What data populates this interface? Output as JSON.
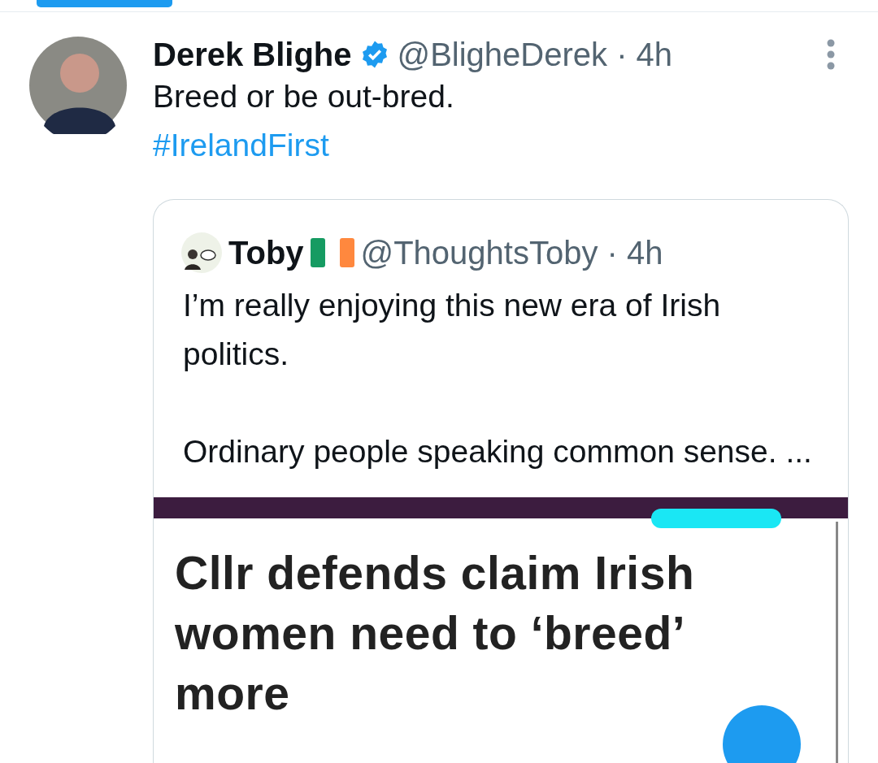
{
  "tweet": {
    "author": "Derek Blighe",
    "verified": true,
    "meta": "@BligheDerek · 4h",
    "text": "Breed or be out-bred.",
    "hashtag": "#IrelandFirst",
    "quote": {
      "author": "Toby",
      "meta": "@ThoughtsToby · 4h",
      "paragraphs": [
        "I’m really enjoying this new era of Irish politics.",
        "Ordinary people speaking common sense. ..."
      ],
      "headline": "Cllr defends claim Irish women need to ‘breed’ more"
    }
  }
}
